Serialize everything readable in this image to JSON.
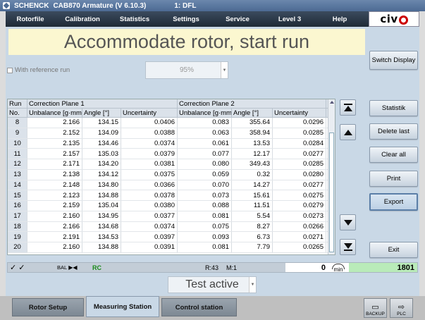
{
  "titlebar": {
    "brand": "SCHENCK",
    "app": "CAB870 Armature (V 6.10.3)",
    "station": "1: DFL"
  },
  "menu": {
    "items": [
      "Rotorfile",
      "Calibration",
      "Statistics",
      "Settings",
      "Service",
      "Level 3",
      "Help"
    ],
    "logo_text": "civ"
  },
  "banner": {
    "text": "Accommodate rotor, start run"
  },
  "reference": {
    "label": "With reference run",
    "checked": false,
    "percent": "95%"
  },
  "right_buttons": {
    "switch_display": "Switch Display",
    "statistik": "Statistik",
    "delete_last": "Delete last",
    "clear_all": "Clear all",
    "print": "Print",
    "export": "Export",
    "exit": "Exit"
  },
  "table": {
    "header1": {
      "run": "Run",
      "plane1": "Correction Plane 1",
      "plane2": "Correction Plane 2"
    },
    "header2": {
      "no": "No.",
      "ub1": "Unbalance [g·mm]",
      "ang1": "Angle [°]",
      "unc1": "Uncertainty",
      "ub2": "Unbalance [g·mm]",
      "ang2": "Angle [°]",
      "unc2": "Uncertainty"
    },
    "rows": [
      [
        "8",
        "2.166",
        "134.15",
        "0.0406",
        "0.083",
        "355.64",
        "0.0296"
      ],
      [
        "9",
        "2.152",
        "134.09",
        "0.0388",
        "0.063",
        "358.94",
        "0.0285"
      ],
      [
        "10",
        "2.135",
        "134.46",
        "0.0374",
        "0.061",
        "13.53",
        "0.0284"
      ],
      [
        "11",
        "2.157",
        "135.03",
        "0.0379",
        "0.077",
        "12.17",
        "0.0277"
      ],
      [
        "12",
        "2.171",
        "134.20",
        "0.0381",
        "0.080",
        "349.43",
        "0.0285"
      ],
      [
        "13",
        "2.138",
        "134.12",
        "0.0375",
        "0.059",
        "0.32",
        "0.0280"
      ],
      [
        "14",
        "2.148",
        "134.80",
        "0.0366",
        "0.070",
        "14.27",
        "0.0277"
      ],
      [
        "15",
        "2.123",
        "134.88",
        "0.0378",
        "0.073",
        "15.61",
        "0.0275"
      ],
      [
        "16",
        "2.159",
        "135.04",
        "0.0380",
        "0.088",
        "11.51",
        "0.0279"
      ],
      [
        "17",
        "2.160",
        "134.95",
        "0.0377",
        "0.081",
        "5.54",
        "0.0273"
      ],
      [
        "18",
        "2.166",
        "134.68",
        "0.0374",
        "0.075",
        "8.27",
        "0.0266"
      ],
      [
        "19",
        "2.191",
        "134.53",
        "0.0397",
        "0.093",
        "6.73",
        "0.0271"
      ],
      [
        "20",
        "2.160",
        "134.88",
        "0.0391",
        "0.081",
        "7.79",
        "0.0265"
      ]
    ]
  },
  "status": {
    "checks": "✓ ✓",
    "bal": "BAL",
    "rc": "RC",
    "r": "R:43",
    "m": "M:1",
    "count": "0",
    "min_unit": "min",
    "total": "1801"
  },
  "test_state": {
    "text": "Test active"
  },
  "bottom": {
    "tabs": [
      "Rotor Setup",
      "Measuring Station",
      "Control station"
    ],
    "active_tab": "Measuring Station",
    "backup_label": "BACKUP",
    "plc_label": "PLC"
  }
}
